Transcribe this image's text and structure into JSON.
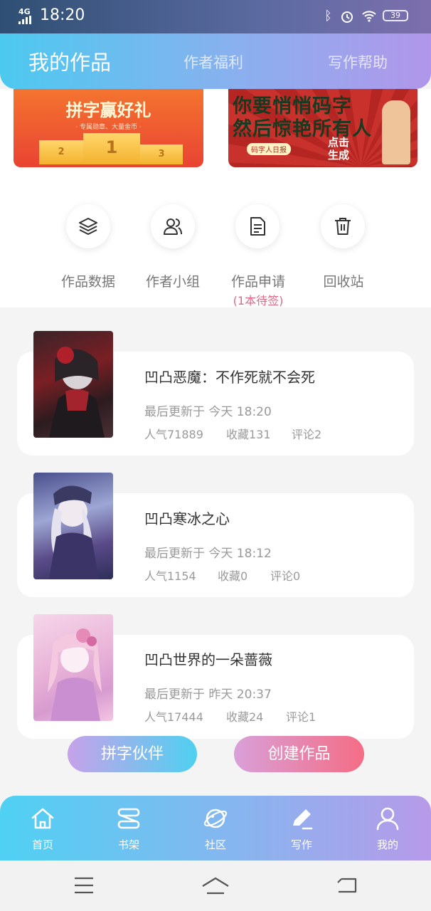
{
  "status_bar": {
    "network": "4G",
    "time": "18:20",
    "battery": "39"
  },
  "header": {
    "tabs": [
      "我的作品",
      "作者福利",
      "写作帮助"
    ]
  },
  "banners": {
    "left": {
      "title": "拼字赢好礼",
      "subtitle": "· 专属勋章、大量金币 ·",
      "podium": [
        "2",
        "1",
        "3"
      ]
    },
    "right": {
      "line1": "你要悄悄码字",
      "line2": "然后惊艳所有人",
      "tag": "码字人日报",
      "cta": "点击生成"
    }
  },
  "quick_actions": [
    {
      "label": "作品数据",
      "icon": "layers-icon"
    },
    {
      "label": "作者小组",
      "icon": "group-icon"
    },
    {
      "label": "作品申请",
      "icon": "document-icon",
      "badge": "(1本待签)"
    },
    {
      "label": "回收站",
      "icon": "trash-icon"
    }
  ],
  "works": [
    {
      "title": "凹凸恶魔：不作死就不会死",
      "updated": "最后更新于 今天 18:20",
      "popularity": "人气71889",
      "favorites": "收藏131",
      "comments": "评论2"
    },
    {
      "title": "凹凸寒冰之心",
      "updated": "最后更新于 今天 18:12",
      "popularity": "人气1154",
      "favorites": "收藏0",
      "comments": "评论0"
    },
    {
      "title": "凹凸世界的一朵蔷薇",
      "updated": "最后更新于 昨天 20:37",
      "popularity": "人气17444",
      "favorites": "收藏24",
      "comments": "评论1"
    }
  ],
  "floating_buttons": {
    "partner": "拼字伙伴",
    "create": "创建作品"
  },
  "bottom_nav": [
    {
      "label": "首页",
      "icon": "home-icon"
    },
    {
      "label": "书架",
      "icon": "bookshelf-icon"
    },
    {
      "label": "社区",
      "icon": "planet-icon"
    },
    {
      "label": "写作",
      "icon": "pen-icon"
    },
    {
      "label": "我的",
      "icon": "user-icon"
    }
  ],
  "colors": {
    "header_start": "#4cc9ef",
    "header_end": "#b196ea",
    "badge": "#e06a86",
    "create_button": "#f46d85"
  }
}
